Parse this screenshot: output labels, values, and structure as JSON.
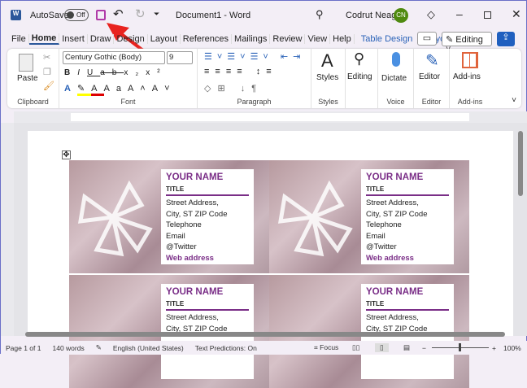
{
  "titlebar": {
    "autosave": "AutoSave",
    "toggle": "Off",
    "doc_title": "Document1 - Word",
    "user": "Codrut Neagu",
    "avatar": "CN"
  },
  "tabs": [
    "File",
    "Home",
    "Insert",
    "Draw",
    "Design",
    "Layout",
    "References",
    "Mailings",
    "Review",
    "View",
    "Help"
  ],
  "context_tabs": [
    "Table Design",
    "Layout"
  ],
  "editing_button": "Editing",
  "ribbon": {
    "paste": "Paste",
    "clipboard": "Clipboard",
    "font_name": "Century Gothic (Body)",
    "font_size": "9",
    "font": "Font",
    "paragraph": "Paragraph",
    "styles": "Styles",
    "styles_group": "Styles",
    "editing": "Editing",
    "dictate": "Dictate",
    "voice": "Voice",
    "editor": "Editor",
    "editor_group": "Editor",
    "addins": "Add-ins",
    "addins_group": "Add-ins"
  },
  "card": {
    "name": "YOUR NAME",
    "title": "TITLE",
    "address1": "Street Address,",
    "address2": "City, ST ZIP Code",
    "phone": "Telephone",
    "email": "Email",
    "twitter": "@Twitter",
    "web": "Web address"
  },
  "status": {
    "page": "Page 1 of 1",
    "words": "140 words",
    "language": "English (United States)",
    "predictions": "Text Predictions: On",
    "focus": "Focus",
    "zoom": "100%"
  },
  "colors": {
    "accent": "#7a2e87",
    "word_blue": "#2b579a"
  }
}
